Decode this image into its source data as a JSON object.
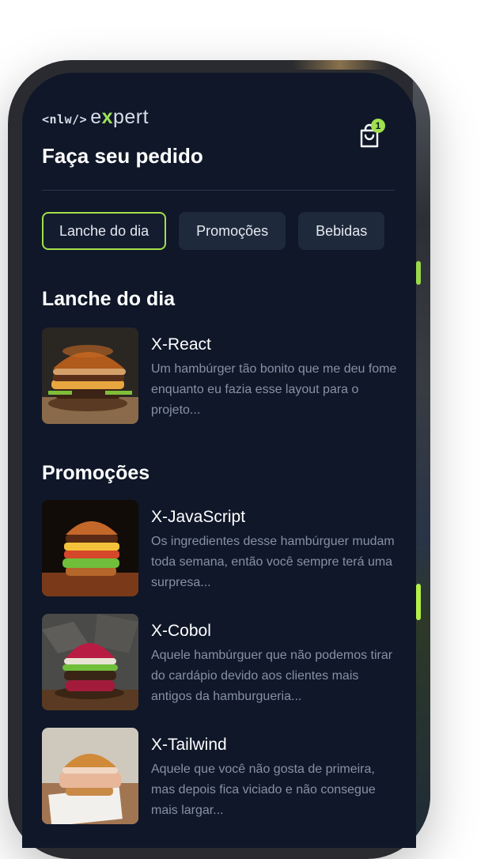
{
  "brand": {
    "prefix": "<nlw/>",
    "name_start": "e",
    "name_x": "x",
    "name_end": "pert"
  },
  "header": {
    "title": "Faça seu pedido",
    "cart_count": "1"
  },
  "tabs": [
    {
      "label": "Lanche do dia",
      "active": true
    },
    {
      "label": "Promoções",
      "active": false
    },
    {
      "label": "Bebidas",
      "active": false
    }
  ],
  "sections": [
    {
      "title": "Lanche do dia",
      "items": [
        {
          "name": "X-React",
          "description": "Um hambúrger tão bonito que me deu fome enquanto eu fazia esse layout para o projeto..."
        }
      ]
    },
    {
      "title": "Promoções",
      "items": [
        {
          "name": "X-JavaScript",
          "description": "Os ingredientes desse hambúrguer mudam toda semana, então você sempre terá uma surpresa..."
        },
        {
          "name": "X-Cobol",
          "description": "Aquele hambúrguer que não podemos tirar do cardápio devido aos clientes mais antigos da hamburgueria..."
        },
        {
          "name": "X-Tailwind",
          "description": "Aquele que você não gosta de primeira, mas depois fica viciado e não consegue mais largar..."
        }
      ]
    }
  ],
  "colors": {
    "background": "#0f1729",
    "accent": "#a3e04a",
    "card": "#1e293b",
    "muted_text": "#8791a5"
  }
}
